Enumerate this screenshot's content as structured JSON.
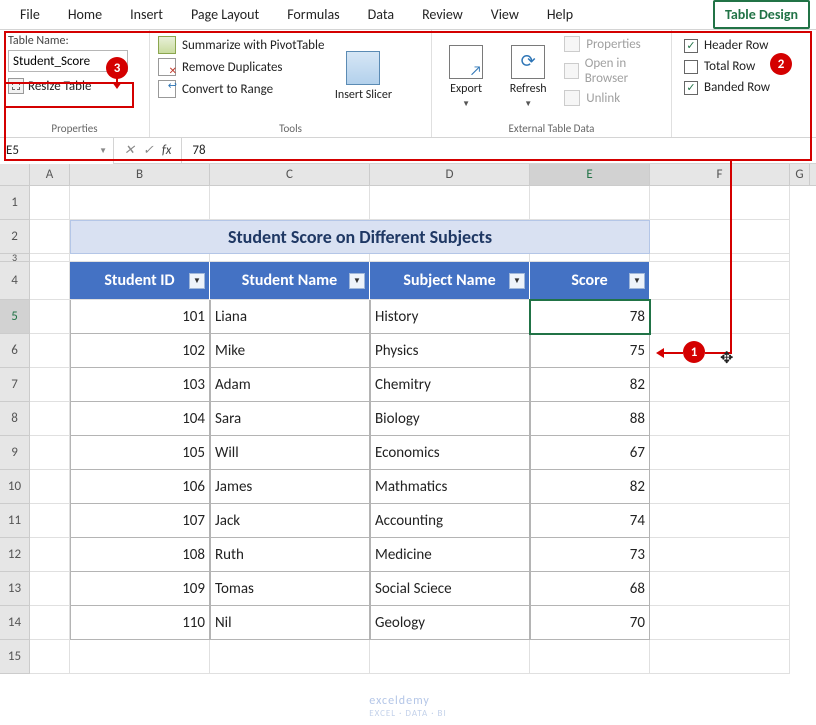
{
  "menu": {
    "tabs": [
      "File",
      "Home",
      "Insert",
      "Page Layout",
      "Formulas",
      "Data",
      "Review",
      "View",
      "Help",
      "Table Design"
    ]
  },
  "ribbon": {
    "properties": {
      "tbl_name_label": "Table Name:",
      "tbl_name_value": "Student_Score",
      "resize": "Resize Table",
      "group_label": "Properties"
    },
    "tools": {
      "pivot": "Summarize with PivotTable",
      "dup": "Remove Duplicates",
      "range": "Convert to Range",
      "slicer": "Insert Slicer",
      "group_label": "Tools"
    },
    "ext": {
      "export": "Export",
      "refresh": "Refresh",
      "props": "Properties",
      "browser": "Open in Browser",
      "unlink": "Unlink",
      "group_label": "External Table Data"
    },
    "opts": {
      "header": "Header Row",
      "total": "Total Row",
      "banded": "Banded Row"
    }
  },
  "fbar": {
    "name": "E5",
    "value": "78"
  },
  "cols": [
    "A",
    "B",
    "C",
    "D",
    "E",
    "F",
    "G"
  ],
  "row_nums": [
    "1",
    "2",
    "3",
    "4",
    "5",
    "6",
    "7",
    "8",
    "9",
    "10",
    "11",
    "12",
    "13",
    "14",
    "15"
  ],
  "sheet": {
    "title": "Student Score on Different Subjects",
    "headers": [
      "Student ID",
      "Student Name",
      "Subject Name",
      "Score"
    ],
    "rows": [
      {
        "id": "101",
        "name": "Liana",
        "subj": "History",
        "score": "78"
      },
      {
        "id": "102",
        "name": "Mike",
        "subj": "Physics",
        "score": "75"
      },
      {
        "id": "103",
        "name": "Adam",
        "subj": "Chemitry",
        "score": "82"
      },
      {
        "id": "104",
        "name": "Sara",
        "subj": "Biology",
        "score": "88"
      },
      {
        "id": "105",
        "name": "Will",
        "subj": "Economics",
        "score": "67"
      },
      {
        "id": "106",
        "name": "James",
        "subj": "Mathmatics",
        "score": "82"
      },
      {
        "id": "107",
        "name": "Jack",
        "subj": "Accounting",
        "score": "74"
      },
      {
        "id": "108",
        "name": "Ruth",
        "subj": "Medicine",
        "score": "73"
      },
      {
        "id": "109",
        "name": "Tomas",
        "subj": "Social Sciece",
        "score": "68"
      },
      {
        "id": "110",
        "name": "Nil",
        "subj": "Geology",
        "score": "70"
      }
    ]
  },
  "watermark": {
    "main": "exceldemy",
    "sub": "EXCEL · DATA · BI"
  },
  "callouts": {
    "c1": "1",
    "c2": "2",
    "c3": "3"
  }
}
